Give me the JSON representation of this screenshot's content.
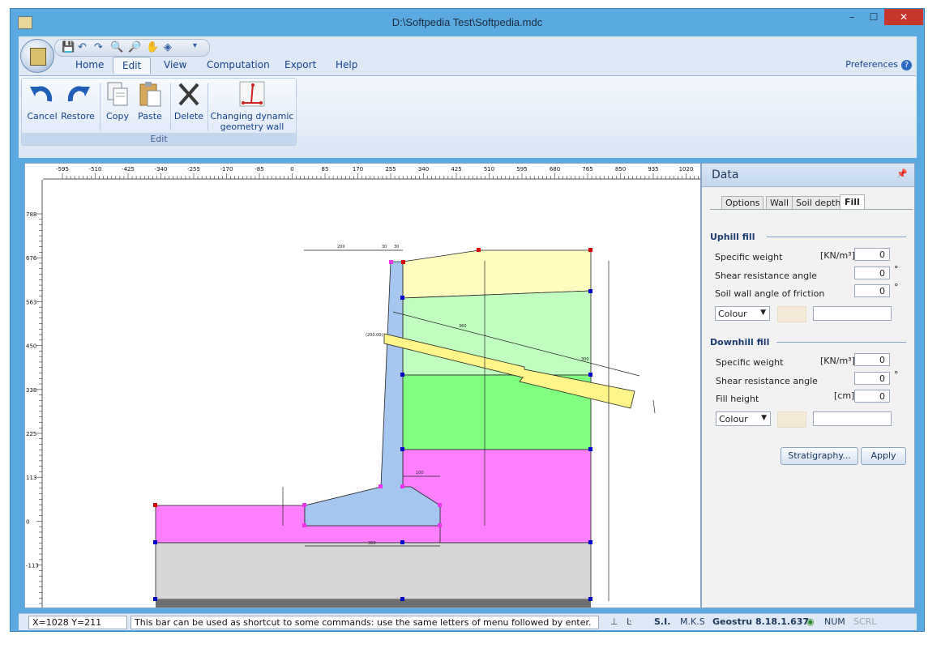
{
  "window": {
    "title": "D:\\Softpedia Test\\Softpedia.mdc",
    "close_label": "✕",
    "max_label": "☐",
    "min_label": "–"
  },
  "ribbon": {
    "tabs": [
      "Home",
      "Edit",
      "View",
      "Computation",
      "Export",
      "Help"
    ],
    "active_tab": "Edit",
    "preferences": "Preferences",
    "help_glyph": "?",
    "group_label": "Edit",
    "buttons": {
      "cancel": "Cancel",
      "restore": "Restore",
      "copy": "Copy",
      "paste": "Paste",
      "delete": "Delete",
      "dynamic_line1": "Changing dynamic",
      "dynamic_line2": "geometry wall"
    }
  },
  "ruler": {
    "x_ticks": [
      "-595",
      "-510",
      "-425",
      "-340",
      "-255",
      "-170",
      "-85",
      "0",
      "85",
      "170",
      "255",
      "340",
      "425",
      "510",
      "595",
      "680",
      "765",
      "850",
      "935",
      "1020"
    ],
    "y_ticks": [
      "788",
      "676",
      "563",
      "450",
      "338",
      "225",
      "113",
      "0",
      "-113"
    ]
  },
  "drawing": {
    "dims": {
      "d200": "200",
      "d30a": "30",
      "d30b": "30",
      "d360": "360",
      "d300": "300",
      "d20000": "(200.00)",
      "d100": "100",
      "d360b": "360"
    }
  },
  "panel": {
    "title": "Data",
    "pin": "📌",
    "tabs": [
      "Options",
      "Wall",
      "Soil depth",
      "Fill"
    ],
    "active_tab": "Fill",
    "uphill": {
      "title": "Uphill fill",
      "specific_weight_label": "Specific weight",
      "unit_weight": "[KN/m³]",
      "specific_weight": "0",
      "shear_label": "Shear resistance angle",
      "shear": "0",
      "deg1": "°",
      "friction_label": "Soil wall angle of friction",
      "friction": "0",
      "deg2": "°",
      "colour_label": "Colour"
    },
    "downhill": {
      "title": "Downhill fill",
      "specific_weight_label": "Specific weight",
      "unit_weight": "[KN/m³]",
      "specific_weight": "0",
      "shear_label": "Shear resistance angle",
      "shear": "0",
      "deg1": "°",
      "fill_height_label": "Fill height",
      "unit_cm": "[cm]",
      "fill_height": "0",
      "colour_label": "Colour"
    },
    "buttons": {
      "stratigraphy": "Stratigraphy...",
      "apply": "Apply"
    }
  },
  "status": {
    "coords": "X=1028  Y=211",
    "hint": "This bar can be used as shortcut to some commands: use the same letters of menu followed by enter.",
    "units": "S.I.",
    "mks": "M.K.S",
    "product": "Geostru 8.18.1.637",
    "num": "NUM",
    "scrl": "SCRL"
  },
  "colors": {
    "accent": "#5aa9e0",
    "yellow_fill": "#fffcc0",
    "light_green": "#c0ffc0",
    "green": "#80ff80",
    "magenta": "#ff80ff",
    "wall_blue": "#a5c6ee",
    "grey": "#d6d6d6"
  }
}
